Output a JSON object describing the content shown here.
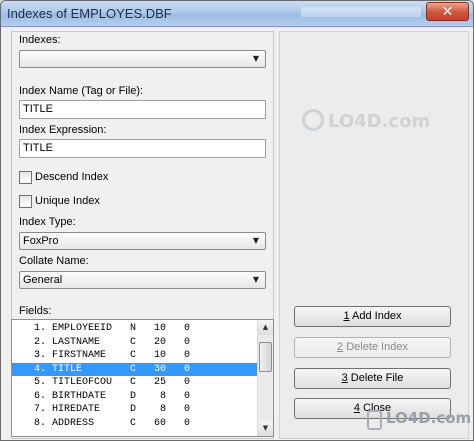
{
  "window": {
    "title": "Indexes of EMPLOYES.DBF",
    "close_glyph": "✕"
  },
  "form": {
    "indexes_label": "Indexes:",
    "indexes_value": "",
    "index_name_label": "Index Name (Tag or File):",
    "index_name_value": "TITLE",
    "index_expression_label": "Index Expression:",
    "index_expression_value": "TITLE",
    "descend_label": "Descend Index",
    "descend_checked": false,
    "unique_label": "Unique Index",
    "unique_checked": false,
    "index_type_label": "Index Type:",
    "index_type_value": "FoxPro",
    "collate_label": "Collate Name:",
    "collate_value": "General",
    "fields_label": "Fields:"
  },
  "fields": [
    {
      "text": " 1. EMPLOYEEID   N   10   0"
    },
    {
      "text": " 2. LASTNAME     C   20   0"
    },
    {
      "text": " 3. FIRSTNAME    C   10   0"
    },
    {
      "text": " 4. TITLE        C   30   0"
    },
    {
      "text": " 5. TITLEOFCOU   C   25   0"
    },
    {
      "text": " 6. BIRTHDATE    D    8   0"
    },
    {
      "text": " 7. HIREDATE     D    8   0"
    },
    {
      "text": " 8. ADDRESS      C   60   0"
    }
  ],
  "selected_field_index": 3,
  "buttons": {
    "add_index": {
      "mnemonic": "1",
      "label": " Add Index"
    },
    "delete_index": {
      "mnemonic": "2",
      "label": " Delete Index"
    },
    "delete_file": {
      "mnemonic": "3",
      "label": " Delete File"
    },
    "close": {
      "mnemonic": "4",
      "label": " Close"
    }
  },
  "watermark": {
    "text": "LO4D.com"
  },
  "icons": {
    "dropdown": "▼",
    "scroll_up": "▲",
    "scroll_down": "▼"
  }
}
